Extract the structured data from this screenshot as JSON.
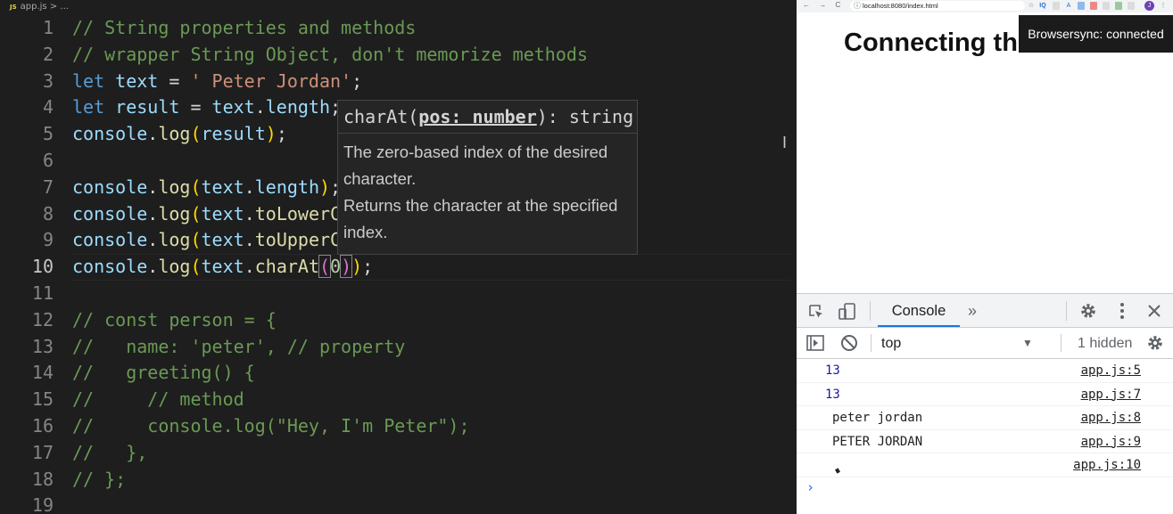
{
  "editor": {
    "breadcrumb": {
      "file_badge": "JS",
      "file": "app.js",
      "sep": ">",
      "rest": "..."
    },
    "lines": [
      {
        "n": "1",
        "segs": [
          {
            "t": "c",
            "x": "// String properties and methods"
          }
        ]
      },
      {
        "n": "2",
        "segs": [
          {
            "t": "c",
            "x": "// wrapper String Object, don't memorize methods"
          }
        ]
      },
      {
        "n": "3",
        "segs": [
          {
            "t": "k",
            "x": "let"
          },
          {
            "t": "",
            "x": " "
          },
          {
            "t": "v",
            "x": "text"
          },
          {
            "t": "",
            "x": " = "
          },
          {
            "t": "s",
            "x": "' Peter Jordan'"
          },
          {
            "t": "",
            "x": ";"
          }
        ]
      },
      {
        "n": "4",
        "segs": [
          {
            "t": "k",
            "x": "let"
          },
          {
            "t": "",
            "x": " "
          },
          {
            "t": "v",
            "x": "result"
          },
          {
            "t": "",
            "x": " = "
          },
          {
            "t": "v",
            "x": "text"
          },
          {
            "t": "",
            "x": "."
          },
          {
            "t": "v",
            "x": "length"
          },
          {
            "t": "",
            "x": ";"
          }
        ]
      },
      {
        "n": "5",
        "segs": [
          {
            "t": "v",
            "x": "console"
          },
          {
            "t": "",
            "x": "."
          },
          {
            "t": "f",
            "x": "log"
          },
          {
            "t": "p1",
            "x": "("
          },
          {
            "t": "v",
            "x": "result"
          },
          {
            "t": "p1",
            "x": ")"
          },
          {
            "t": "",
            "x": ";"
          }
        ]
      },
      {
        "n": "6",
        "segs": []
      },
      {
        "n": "7",
        "segs": [
          {
            "t": "v",
            "x": "console"
          },
          {
            "t": "",
            "x": "."
          },
          {
            "t": "f",
            "x": "log"
          },
          {
            "t": "p1",
            "x": "("
          },
          {
            "t": "v",
            "x": "text"
          },
          {
            "t": "",
            "x": "."
          },
          {
            "t": "v",
            "x": "length"
          },
          {
            "t": "p1",
            "x": ")"
          },
          {
            "t": "",
            "x": ";"
          }
        ]
      },
      {
        "n": "8",
        "segs": [
          {
            "t": "v",
            "x": "console"
          },
          {
            "t": "",
            "x": "."
          },
          {
            "t": "f",
            "x": "log"
          },
          {
            "t": "p1",
            "x": "("
          },
          {
            "t": "v",
            "x": "text"
          },
          {
            "t": "",
            "x": "."
          },
          {
            "t": "f",
            "x": "toLowerC"
          }
        ]
      },
      {
        "n": "9",
        "segs": [
          {
            "t": "v",
            "x": "console"
          },
          {
            "t": "",
            "x": "."
          },
          {
            "t": "f",
            "x": "log"
          },
          {
            "t": "p1",
            "x": "("
          },
          {
            "t": "v",
            "x": "text"
          },
          {
            "t": "",
            "x": "."
          },
          {
            "t": "f",
            "x": "toUpperC"
          }
        ]
      },
      {
        "n": "10",
        "current": true,
        "segs": [
          {
            "t": "v",
            "x": "console"
          },
          {
            "t": "",
            "x": "."
          },
          {
            "t": "f",
            "x": "log"
          },
          {
            "t": "p1",
            "x": "("
          },
          {
            "t": "v",
            "x": "text"
          },
          {
            "t": "",
            "x": "."
          },
          {
            "t": "f",
            "x": "charAt"
          },
          {
            "t": "p2 bm",
            "x": "("
          },
          {
            "t": "n",
            "x": "0"
          },
          {
            "t": "p2 bm",
            "x": ")"
          },
          {
            "t": "p1",
            "x": ")"
          },
          {
            "t": "",
            "x": ";"
          }
        ]
      },
      {
        "n": "11",
        "segs": []
      },
      {
        "n": "12",
        "segs": [
          {
            "t": "c",
            "x": "// const person = {"
          }
        ]
      },
      {
        "n": "13",
        "segs": [
          {
            "t": "c",
            "x": "//   name: 'peter', // property"
          }
        ]
      },
      {
        "n": "14",
        "segs": [
          {
            "t": "c",
            "x": "//   greeting() {"
          }
        ]
      },
      {
        "n": "15",
        "segs": [
          {
            "t": "c",
            "x": "//     // method"
          }
        ]
      },
      {
        "n": "16",
        "segs": [
          {
            "t": "c",
            "x": "//     console.log(\"Hey, I'm Peter\");"
          }
        ]
      },
      {
        "n": "17",
        "segs": [
          {
            "t": "c",
            "x": "//   },"
          }
        ]
      },
      {
        "n": "18",
        "segs": [
          {
            "t": "c",
            "x": "// };"
          }
        ]
      },
      {
        "n": "19",
        "segs": []
      }
    ],
    "hover": {
      "sig_name": "charAt(",
      "sig_param": "pos: number",
      "sig_rest": "): string",
      "doc1": "The zero-based index of the desired character.",
      "doc2": "Returns the character at the specified index."
    },
    "stray_glyph": "I"
  },
  "browser": {
    "nav": "←  →  C",
    "lock": "ⓘ",
    "url": "localhost:8080/index.html",
    "ext_labels": [
      "☆",
      "IQ",
      "",
      "A",
      "",
      "",
      "",
      "",
      "",
      "",
      "⋮"
    ],
    "avatar": "J",
    "page_heading": "Connecting the Dots",
    "toast": "Browsersync: connected"
  },
  "devtools": {
    "tab": "Console",
    "more_tabs": "»",
    "context": "top",
    "hidden": "1 hidden",
    "messages": [
      {
        "value": "13",
        "type": "number",
        "loc": "app.js:5"
      },
      {
        "value": "13",
        "type": "number",
        "loc": "app.js:7"
      },
      {
        "value": "peter jordan",
        "type": "string",
        "loc": "app.js:8"
      },
      {
        "value": "PETER JORDAN",
        "type": "string",
        "loc": "app.js:9"
      },
      {
        "value": "",
        "type": "string",
        "loc": "app.js:10"
      }
    ],
    "prompt": "›"
  }
}
